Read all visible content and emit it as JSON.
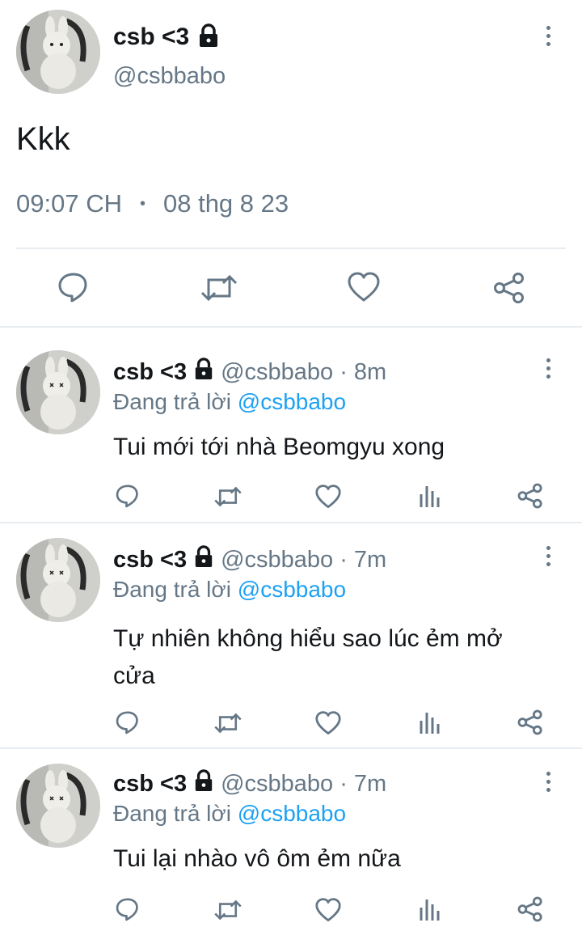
{
  "main_tweet": {
    "display_name": "csb <3",
    "handle": "@csbbabo",
    "text": "Kkk",
    "time": "09:07 CH",
    "separator": "•",
    "date": "08 thg 8 23"
  },
  "replies": [
    {
      "display_name": "csb <3",
      "handle": "@csbbabo",
      "age": "· 8m",
      "replying_prefix": "Đang trả lời",
      "replying_to": "@csbbabo",
      "text_lines": [
        "Tui mới tới nhà Beomgyu xong"
      ]
    },
    {
      "display_name": "csb <3",
      "handle": "@csbbabo",
      "age": "· 7m",
      "replying_prefix": "Đang trả lời",
      "replying_to": "@csbbabo",
      "text_lines": [
        "Tự nhiên không hiểu sao lúc ẻm mở",
        "cửa"
      ]
    },
    {
      "display_name": "csb <3",
      "handle": "@csbbabo",
      "age": "· 7m",
      "replying_prefix": "Đang trả lời",
      "replying_to": "@csbbabo",
      "text_lines": [
        "Tui lại nhào vô ôm ẻm nữa"
      ]
    }
  ],
  "icons": {
    "reply": "reply-icon",
    "retweet": "retweet-icon",
    "like": "heart-icon",
    "analytics": "analytics-icon",
    "share": "share-icon",
    "lock": "lock-icon",
    "more": "more-vertical-icon"
  },
  "colors": {
    "text": "#14171a",
    "muted": "#657786",
    "link": "#1da1f2",
    "divider": "#e6ecf0"
  }
}
